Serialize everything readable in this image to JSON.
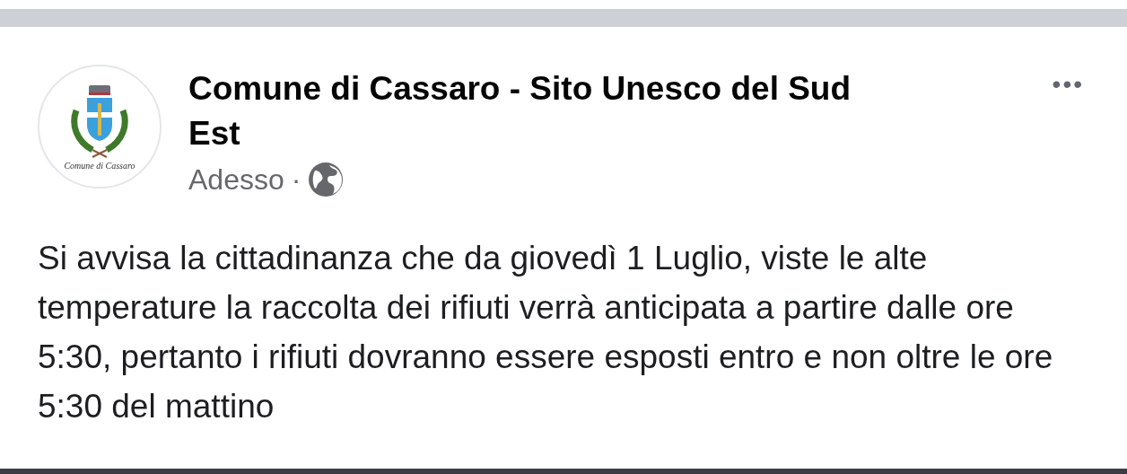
{
  "post": {
    "author": "Comune di Cassaro - Sito Unesco del Sud Est",
    "avatar_caption": "Comune di Cassaro",
    "time": "Adesso",
    "separator": "·",
    "public": true,
    "more": "•••",
    "text": "Si avvisa la cittadinanza che da giovedì 1 Luglio, viste le alte temperature la raccolta dei rifiuti verrà anticipata a partire dalle ore 5:30, pertanto i rifiuti dovranno essere esposti entro e non oltre le ore 5:30 del mattino"
  }
}
